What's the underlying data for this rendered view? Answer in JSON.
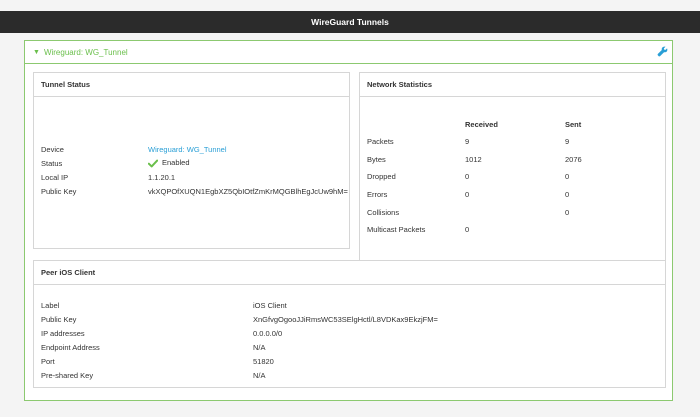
{
  "topbar": {
    "title": "WireGuard Tunnels"
  },
  "section": {
    "title": "Wireguard: WG_Tunnel"
  },
  "tunnel_status": {
    "title": "Tunnel Status",
    "rows": [
      {
        "label": "Device",
        "value": "Wireguard: WG_Tunnel"
      },
      {
        "label": "Status",
        "value": "Enabled"
      },
      {
        "label": "Local IP",
        "value": "1.1.20.1"
      },
      {
        "label": "Public Key",
        "value": "vkXQPOfXUQN1EgbXZ5QbIOtfZmKrMQGBlhEgJcUw9hM="
      }
    ]
  },
  "network_statistics": {
    "title": "Network Statistics",
    "columns": [
      "Received",
      "Sent"
    ],
    "rows": [
      {
        "label": "Packets",
        "received": "9",
        "sent": "9"
      },
      {
        "label": "Bytes",
        "received": "1012",
        "sent": "2076"
      },
      {
        "label": "Dropped",
        "received": "0",
        "sent": "0"
      },
      {
        "label": "Errors",
        "received": "0",
        "sent": "0"
      },
      {
        "label": "Collisions",
        "received": "",
        "sent": "0"
      },
      {
        "label": "Multicast Packets",
        "received": "0",
        "sent": ""
      }
    ]
  },
  "peer": {
    "title": "Peer iOS Client",
    "rows": [
      {
        "label": "Label",
        "value": "iOS Client"
      },
      {
        "label": "Public Key",
        "value": "XnGfvgOgooJJiRmsWC53SElgHctl/L8VDKax9EkzjFM="
      },
      {
        "label": "IP addresses",
        "value": "0.0.0.0/0"
      },
      {
        "label": "Endpoint Address",
        "value": "N/A"
      },
      {
        "label": "Port",
        "value": "51820"
      },
      {
        "label": "Pre-shared Key",
        "value": "N/A"
      }
    ]
  },
  "colors": {
    "accent": "#6abf4b",
    "link": "#2a9fd6",
    "topbar": "#2b2b2b"
  },
  "icons": {
    "wrench": "wrench-icon",
    "check": "check-icon",
    "caret": "caret-down-icon"
  }
}
